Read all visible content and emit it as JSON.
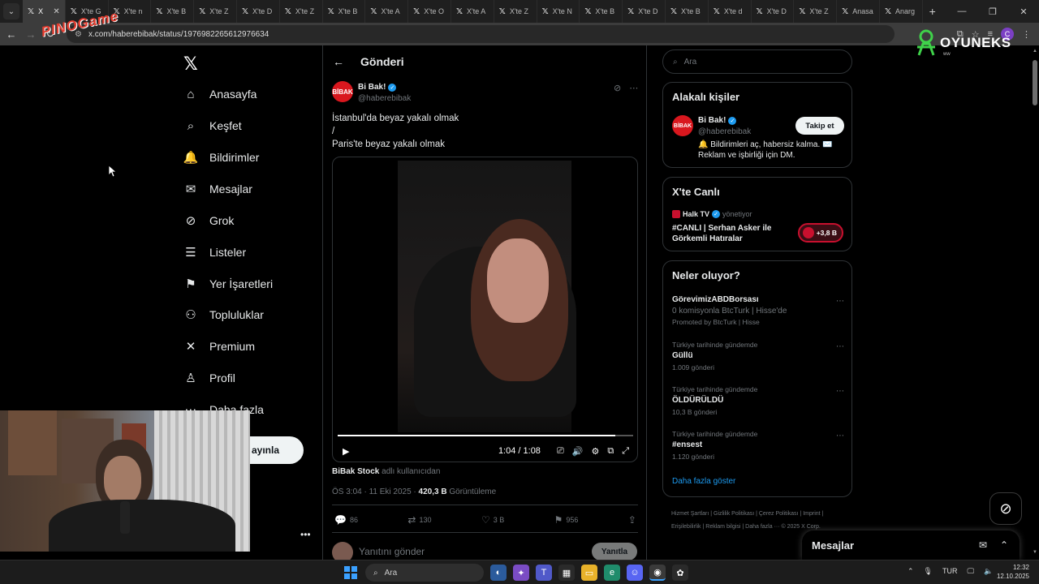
{
  "browser": {
    "tabs": [
      {
        "label": "X",
        "active": true
      },
      {
        "label": "X'te G"
      },
      {
        "label": "X'te n"
      },
      {
        "label": "X'te B"
      },
      {
        "label": "X'te Z"
      },
      {
        "label": "X'te D"
      },
      {
        "label": "X'te Z"
      },
      {
        "label": "X'te B"
      },
      {
        "label": "X'te A"
      },
      {
        "label": "X'te O"
      },
      {
        "label": "X'te A"
      },
      {
        "label": "X'te Z"
      },
      {
        "label": "X'te N"
      },
      {
        "label": "X'te B"
      },
      {
        "label": "X'te D"
      },
      {
        "label": "X'te B"
      },
      {
        "label": "X'te d"
      },
      {
        "label": "X'te D"
      },
      {
        "label": "X'te Z"
      },
      {
        "label": "Anasa"
      },
      {
        "label": "Anarg"
      }
    ],
    "url": "x.com/haberebibak/status/1976982265612976634",
    "profile_initial": "C"
  },
  "overlays": {
    "stream_logo": "PINOGame",
    "sponsor": "OYUNEKS",
    "sponsor_sub": "ww"
  },
  "nav": {
    "items": [
      {
        "label": "Anasayfa",
        "icon": "home-icon",
        "glyph": "⌂"
      },
      {
        "label": "Keşfet",
        "icon": "search-icon",
        "glyph": "⌕"
      },
      {
        "label": "Bildirimler",
        "icon": "bell-icon",
        "glyph": "🔔"
      },
      {
        "label": "Mesajlar",
        "icon": "mail-icon",
        "glyph": "✉"
      },
      {
        "label": "Grok",
        "icon": "grok-icon",
        "glyph": "⊘"
      },
      {
        "label": "Listeler",
        "icon": "list-icon",
        "glyph": "☰"
      },
      {
        "label": "Yer İşaretleri",
        "icon": "bookmark-icon",
        "glyph": "⚑"
      },
      {
        "label": "Topluluklar",
        "icon": "communities-icon",
        "glyph": "⚇"
      },
      {
        "label": "Premium",
        "icon": "x-premium-icon",
        "glyph": "✕"
      },
      {
        "label": "Profil",
        "icon": "profile-icon",
        "glyph": "♙"
      },
      {
        "label": "Daha fazla",
        "icon": "more-icon",
        "glyph": "⋯"
      }
    ],
    "post_button": "ayınla"
  },
  "post": {
    "header_title": "Gönderi",
    "author_name": "Bi Bak!",
    "author_handle": "@haberebibak",
    "avatar_text": "BİBAK",
    "text_lines": [
      "İstanbul'da beyaz yakalı olmak",
      "/",
      "Paris'te beyaz yakalı olmak"
    ],
    "video_time": "1:04 / 1:08",
    "video_progress": 0.94,
    "via_user": "BiBak Stock",
    "via_suffix": " adlı kullanıcıdan",
    "timestamp": "ÖS 3:04 · 11 Eki 2025 · ",
    "views_count": "420,3 B",
    "views_label": " Görüntüleme",
    "replies": "86",
    "reposts": "130",
    "likes": "3 B",
    "bookmarks": "956",
    "reply_placeholder": "Yanıtını gönder",
    "reply_button": "Yanıtla"
  },
  "sidebar": {
    "search_placeholder": "Ara",
    "related": {
      "title": "Alakalı kişiler",
      "name": "Bi Bak!",
      "handle": "@haberebibak",
      "follow": "Takip et",
      "bio": "🔔 Bildirimleri aç, habersiz kalma. ✉️ Reklam ve işbirliği için DM."
    },
    "live": {
      "title": "X'te Canlı",
      "host": "Halk TV",
      "host_role": "yönetiyor",
      "stream_title": "#CANLI | Serhan Asker ile Görkemli Hatıralar",
      "listeners": "+3,8 B"
    },
    "trends": {
      "title": "Neler oluyor?",
      "promoted": {
        "name": "GörevimizABDBorsası",
        "subtitle": "0 komisyonla BtcTurk | Hisse'de",
        "promo": "Promoted by BtcTurk | Hisse"
      },
      "items": [
        {
          "context": "Türkiye tarihinde gündemde",
          "name": "Güllü",
          "count": "1.009 gönderi"
        },
        {
          "context": "Türkiye tarihinde gündemde",
          "name": "ÖLDÜRÜLDÜ",
          "count": "10,3 B gönderi"
        },
        {
          "context": "Türkiye tarihinde gündemde",
          "name": "#ensest",
          "count": "1.120 gönderi"
        }
      ],
      "show_more": "Daha fazla göster"
    },
    "footer": "Hizmet Şartları | Gizlilik Politikası | Çerez Politikası | Imprint | Erişilebilirlik | Reklam bilgisi | Daha fazla ··· © 2025 X Corp."
  },
  "messages_drawer": {
    "title": "Mesajlar"
  },
  "taskbar": {
    "search": "Ara",
    "lang": "TUR",
    "time": "12:32",
    "date": "12.10.2025"
  },
  "colors": {
    "accent": "#1d9bf0",
    "brand_red": "#d9171e",
    "live_red": "#c8102e"
  }
}
